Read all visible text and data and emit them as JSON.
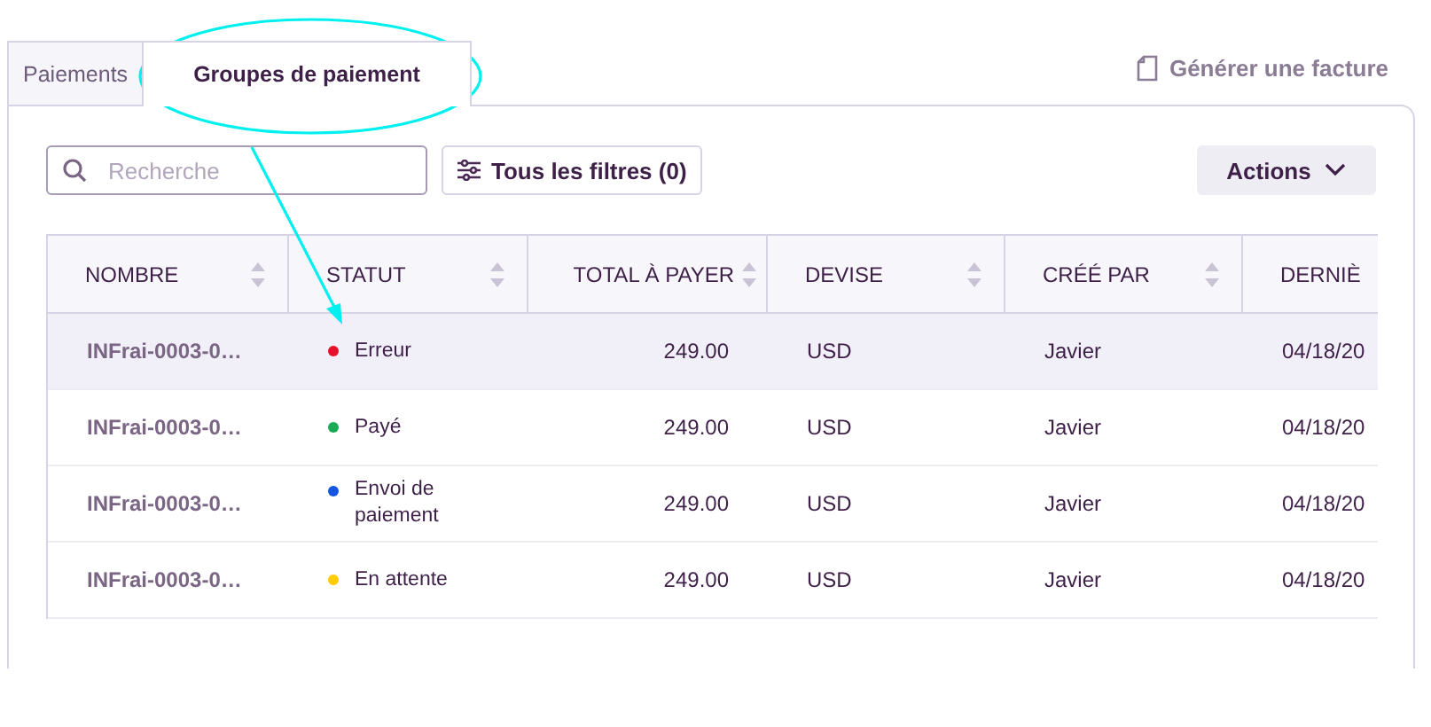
{
  "tabs": [
    {
      "label": "Paiements",
      "selected": false
    },
    {
      "label": "Groupes de paiement",
      "selected": true
    }
  ],
  "invoice_link": "Générer une facture",
  "search": {
    "placeholder": "Recherche"
  },
  "filters_button": "Tous les filtres (0)",
  "actions_button": "Actions",
  "table": {
    "columns": [
      {
        "label": "NOMBRE",
        "sortable": true
      },
      {
        "label": "STATUT",
        "sortable": true
      },
      {
        "label": "TOTAL À PAYER",
        "sortable": true
      },
      {
        "label": "DEVISE",
        "sortable": true
      },
      {
        "label": "CRÉÉ PAR",
        "sortable": true
      },
      {
        "label": "DERNIÈ",
        "sortable": false
      }
    ],
    "rows": [
      {
        "selected": true,
        "name": "INFrai-0003-0…",
        "status": "Erreur",
        "color": "#e8112d",
        "total": "249.00",
        "currency": "USD",
        "created_by": "Javier",
        "date": "04/18/20"
      },
      {
        "selected": false,
        "name": "INFrai-0003-0…",
        "status": "Payé",
        "color": "#1aaa55",
        "total": "249.00",
        "currency": "USD",
        "created_by": "Javier",
        "date": "04/18/20"
      },
      {
        "selected": false,
        "name": "INFrai-0003-0…",
        "status": "Envoi de paiement",
        "color": "#1456e0",
        "total": "249.00",
        "currency": "USD",
        "created_by": "Javier",
        "date": "04/18/20"
      },
      {
        "selected": false,
        "name": "INFrai-0003-0…",
        "status": "En attente",
        "color": "#ffcc00",
        "total": "249.00",
        "currency": "USD",
        "created_by": "Javier",
        "date": "04/18/20"
      }
    ]
  }
}
